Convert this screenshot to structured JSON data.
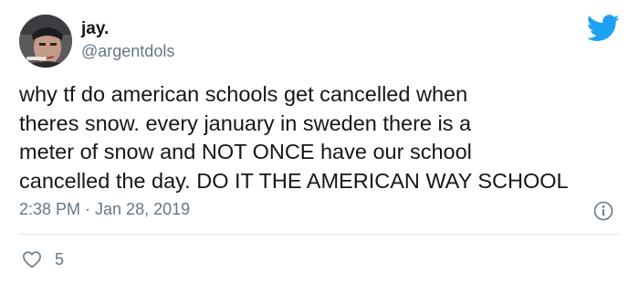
{
  "author": {
    "display_name": "jay.",
    "handle": "@argentdols",
    "avatar_icon": "profile-photo"
  },
  "tweet": {
    "lines": [
      "why tf do american schools get cancelled when",
      "theres snow. every january in sweden there is a",
      "meter of snow and NOT ONCE have our school",
      "cancelled the day. DO IT THE AMERICAN WAY SCHOOL"
    ]
  },
  "meta": {
    "timestamp": "2:38 PM · Jan 28, 2019"
  },
  "actions": {
    "like_count": "5"
  },
  "icons": {
    "brand": "twitter-bird-icon",
    "info": "info-icon",
    "like": "heart-icon"
  },
  "colors": {
    "brand_blue": "#1da1f2",
    "text_primary": "#14171a",
    "text_secondary": "#657786",
    "divider": "#e1e8ed"
  }
}
